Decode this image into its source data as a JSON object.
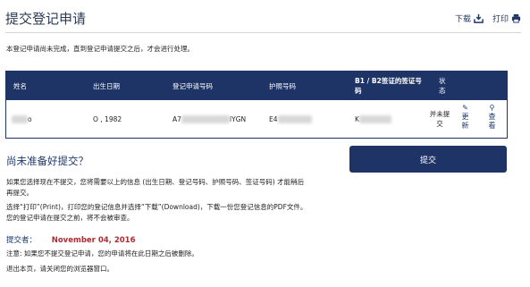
{
  "header": {
    "title": "提交登记申请",
    "download_label": "下载",
    "print_label": "打印",
    "accent_color": "#1f3466"
  },
  "intro_text": "本登记申请尚未完成，直到登记申请提交之后，才会进行处理。",
  "table": {
    "headers": {
      "name": "姓名",
      "dob": "出生日期",
      "app_no": "登记申请号码",
      "passport": "护照号码",
      "visa": "B1 / B2签证的签证号码",
      "status": "状态"
    },
    "row": {
      "name": "o",
      "dob": "O , 1982",
      "app_no_prefix": "A7",
      "app_no_suffix": "IYGN",
      "passport_prefix": "E4",
      "visa_prefix": "K",
      "status": "并未提交",
      "update_label": "更新",
      "view_label": "查看"
    }
  },
  "not_ready_title": "尚未准备好提交？",
  "submit_label": "提交",
  "paragraph1": "如果您选择现在不提交，您将需要以上的信息 (出生日期、登记号码、护照号码、签证号码) 才能稍后再提交。",
  "paragraph2": "选择“打印”(Print)，打印您的登记信息并选择“下载”(Download)，下载一份您登记信息的PDF文件。您的登记申请在提交之前，将不会被审查。",
  "submitted_label": "提交者：",
  "submitted_date": "November 04, 2016",
  "note_text": "注意: 如果您不提交登记申请，您的申请将在此日期之后被删除。",
  "exit_text": "退出本页，请关闭您的浏览器窗口。"
}
